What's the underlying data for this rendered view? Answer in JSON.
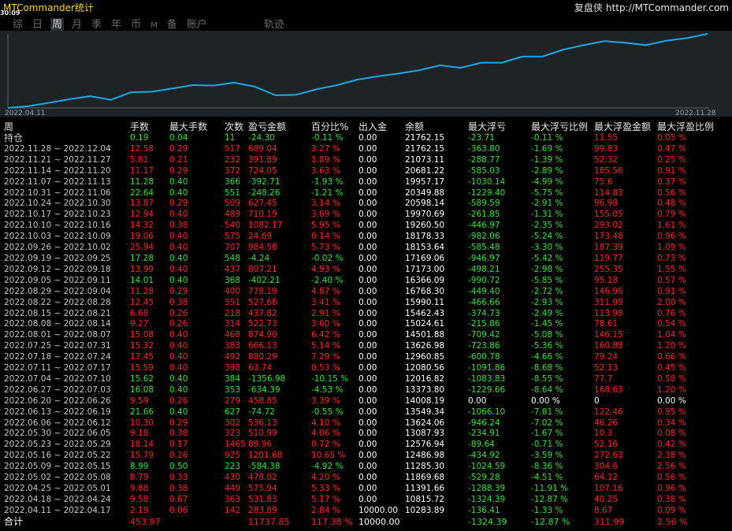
{
  "app": {
    "title": "MTCommander统计",
    "time": "30:09",
    "brand_cn": "复盘侠",
    "brand_url": "http://MTCommander.com"
  },
  "tabs": [
    {
      "label": "综",
      "active": false
    },
    {
      "label": "日",
      "active": false
    },
    {
      "label": "周",
      "active": true
    },
    {
      "label": "月",
      "active": false
    },
    {
      "label": "季",
      "active": false
    },
    {
      "label": "年",
      "active": false
    },
    {
      "label": "币",
      "active": false
    },
    {
      "label": "M",
      "active": false
    },
    {
      "label": "备",
      "active": false
    },
    {
      "label": "账户",
      "active": false
    },
    {
      "label": "轨迹",
      "active": false
    }
  ],
  "chart_data": {
    "type": "line",
    "x_start_label": "2022.04.11",
    "x_end_label": "2022.11.28",
    "line_color": "#1aa7e6",
    "series": [
      {
        "values": [
          10000,
          10283.89,
          10815.72,
          11391.66,
          11869.68,
          11285.3,
          12486.98,
          12576.64,
          13087.93,
          13624.06,
          13549.34,
          14008.19,
          13373.8,
          12016.82,
          12080.56,
          12960.85,
          13626.98,
          14501.88,
          15024.61,
          15462.43,
          15990.11,
          16768.3,
          16366.09,
          17173.0,
          17169.06,
          18153.64,
          18178.33,
          19260.5,
          19970.69,
          20598.14,
          20349.88,
          19957.17,
          20681.22,
          21073.11,
          21762.15
        ]
      }
    ]
  },
  "table": {
    "headers": [
      "周",
      "手数",
      "最大手数",
      "次数",
      "盈亏金额",
      "百分比%",
      "出入金",
      "余额",
      "最大浮亏",
      "最大浮亏比例",
      "最大浮盈金额",
      "最大浮盈比例"
    ],
    "holding": [
      "持仓",
      "0.19",
      "0.04",
      "11",
      "-24.30",
      "-0.11 %",
      "0.00",
      "21762.15",
      "-23.71",
      "-0.11 %",
      "11.55",
      "0.05 %"
    ],
    "rows": [
      [
        "2022.11.28 ~ 2022.12.04",
        "12.58",
        "0.29",
        "517",
        "689.04",
        "3.27 %",
        "0.00",
        "21762.15",
        "-363.80",
        "-1.69 %",
        "99.83",
        "0.47 %"
      ],
      [
        "2022.11.21 ~ 2022.11.27",
        "5.81",
        "0.21",
        "232",
        "391.89",
        "1.89 %",
        "0.00",
        "21073.11",
        "-288.77",
        "-1.39 %",
        "52.32",
        "0.25 %"
      ],
      [
        "2022.11.14 ~ 2022.11.20",
        "11.17",
        "0.29",
        "372",
        "724.05",
        "3.63 %",
        "0.00",
        "20681.22",
        "-585.03",
        "-2.89 %",
        "185.56",
        "0.91 %"
      ],
      [
        "2022.11.07 ~ 2022.11.13",
        "11.28",
        "0.40",
        "366",
        "-392.71",
        "-1.93 %",
        "0.00",
        "19957.17",
        "-1030.14",
        "-4.99 %",
        "75.6",
        "0.37 %"
      ],
      [
        "2022.10.31 ~ 2022.11.06",
        "22.64",
        "0.40",
        "551",
        "-248.26",
        "-1.21 %",
        "0.00",
        "20349.88",
        "-1229.40",
        "-5.75 %",
        "114.83",
        "0.56 %"
      ],
      [
        "2022.10.24 ~ 2022.10.30",
        "13.87",
        "0.29",
        "509",
        "627.45",
        "3.14 %",
        "0.00",
        "20598.14",
        "-589.59",
        "-2.91 %",
        "96.98",
        "0.48 %"
      ],
      [
        "2022.10.17 ~ 2022.10.23",
        "12.94",
        "0.40",
        "489",
        "710.19",
        "3.69 %",
        "0.00",
        "19970.69",
        "-261.85",
        "-1.31 %",
        "155.05",
        "0.79 %"
      ],
      [
        "2022.10.10 ~ 2022.10.16",
        "14.32",
        "0.38",
        "540",
        "1082.17",
        "5.95 %",
        "0.00",
        "19260.50",
        "-446.97",
        "-2.35 %",
        "293.02",
        "1.61 %"
      ],
      [
        "2022.10.03 ~ 2022.10.09",
        "19.06",
        "0.40",
        "575",
        "24.69",
        "0.14 %",
        "0.00",
        "18178.33",
        "-982.06",
        "-5.24 %",
        "173.48",
        "0.96 %"
      ],
      [
        "2022.09.26 ~ 2022.10.02",
        "25.94",
        "0.40",
        "707",
        "984.58",
        "5.73 %",
        "0.00",
        "18153.64",
        "-585.48",
        "-3.30 %",
        "187.39",
        "1.09 %"
      ],
      [
        "2022.09.19 ~ 2022.09.25",
        "17.28",
        "0.40",
        "548",
        "-4.24",
        "-0.02 %",
        "0.00",
        "17169.06",
        "-946.97",
        "-5.42 %",
        "119.77",
        "0.73 %"
      ],
      [
        "2022.09.12 ~ 2022.09.18",
        "13.99",
        "0.40",
        "437",
        "807.21",
        "4.93 %",
        "0.00",
        "17173.00",
        "-498.21",
        "-2.98 %",
        "255.35",
        "1.55 %"
      ],
      [
        "2022.09.05 ~ 2022.09.11",
        "14.01",
        "0.40",
        "368",
        "-402.21",
        "-2.40 %",
        "0.00",
        "16366.09",
        "-990.72",
        "-5.85 %",
        "95.18",
        "0.57 %"
      ],
      [
        "2022.08.29 ~ 2022.09.04",
        "11.28",
        "0.29",
        "400",
        "778.19",
        "4.87 %",
        "0.00",
        "16768.30",
        "-449.40",
        "-2.72 %",
        "146.96",
        "0.91 %"
      ],
      [
        "2022.08.22 ~ 2022.08.28",
        "12.45",
        "0.38",
        "351",
        "527.68",
        "3.41 %",
        "0.00",
        "15990.11",
        "-466.66",
        "-2.93 %",
        "311.99",
        "2.00 %"
      ],
      [
        "2022.08.15 ~ 2022.08.21",
        "6.68",
        "0.26",
        "218",
        "437.82",
        "2.91 %",
        "0.00",
        "15462.43",
        "-374.73",
        "-2.49 %",
        "113.98",
        "0.76 %"
      ],
      [
        "2022.08.08 ~ 2022.08.14",
        "9.27",
        "0.26",
        "314",
        "522.73",
        "3.60 %",
        "0.00",
        "15024.61",
        "-215.86",
        "-1.45 %",
        "78.61",
        "0.54 %"
      ],
      [
        "2022.08.01 ~ 2022.08.07",
        "15.08",
        "0.40",
        "468",
        "874.90",
        "6.42 %",
        "0.00",
        "14501.88",
        "-709.42",
        "-5.08 %",
        "146.15",
        "1.04 %"
      ],
      [
        "2022.07.25 ~ 2022.07.31",
        "15.32",
        "0.40",
        "383",
        "666.13",
        "5.14 %",
        "0.00",
        "13626.98",
        "-723.86",
        "-5.36 %",
        "160.88",
        "1.20 %"
      ],
      [
        "2022.07.18 ~ 2022.07.24",
        "17.45",
        "0.40",
        "492",
        "880.29",
        "7.29 %",
        "0.00",
        "12960.85",
        "-600.78",
        "-4.66 %",
        "79.24",
        "0.66 %"
      ],
      [
        "2022.07.11 ~ 2022.07.17",
        "15.59",
        "0.40",
        "398",
        "63.74",
        "0.53 %",
        "0.00",
        "12080.56",
        "-1091.86",
        "-8.68 %",
        "52.13",
        "0.45 %"
      ],
      [
        "2022.07.04 ~ 2022.07.10",
        "15.62",
        "0.40",
        "384",
        "-1356.98",
        "-10.15 %",
        "0.00",
        "12016.82",
        "-1083.83",
        "-8.55 %",
        "77.7",
        "0.58 %"
      ],
      [
        "2022.06.27 ~ 2022.07.03",
        "16.08",
        "0.40",
        "353",
        "-634.39",
        "-4.53 %",
        "0.00",
        "13373.80",
        "-1229.66",
        "-8.64 %",
        "168.63",
        "1.20 %"
      ],
      [
        "2022.06.20 ~ 2022.06.26",
        "9.59",
        "0.26",
        "279",
        "458.85",
        "3.39 %",
        "0.00",
        "14008.19",
        "0.00",
        "0.00 %",
        "0",
        "0.00 %"
      ],
      [
        "2022.06.13 ~ 2022.06.19",
        "21.66",
        "0.40",
        "627",
        "-74.72",
        "-0.55 %",
        "0.00",
        "13549.34",
        "-1066.10",
        "-7.81 %",
        "122.46",
        "0.95 %"
      ],
      [
        "2022.06.06 ~ 2022.06.12",
        "10.30",
        "0.29",
        "302",
        "536.13",
        "4.10 %",
        "0.00",
        "13624.06",
        "-946.24",
        "-7.02 %",
        "46.26",
        "0.34 %"
      ],
      [
        "2022.05.30 ~ 2022.06.05",
        "9.18",
        "0.38",
        "323",
        "510.99",
        "4.06 %",
        "0.00",
        "13087.93",
        "-234.91",
        "-1.67 %",
        "10.3",
        "0.08 %"
      ],
      [
        "2022.05.23 ~ 2022.05.29",
        "18.14",
        "0.17",
        "1465",
        "89.96",
        "0.72 %",
        "0.00",
        "12576.94",
        "-89.64",
        "-0.71 %",
        "52.16",
        "0.42 %"
      ],
      [
        "2022.05.16 ~ 2022.05.22",
        "15.79",
        "0.26",
        "925",
        "1201.68",
        "10.65 %",
        "0.00",
        "12486.98",
        "-434.92",
        "-3.59 %",
        "272.63",
        "2.38 %"
      ],
      [
        "2022.05.09 ~ 2022.05.15",
        "8.99",
        "0.50",
        "223",
        "-584.38",
        "-4.92 %",
        "0.00",
        "11285.30",
        "-1024.59",
        "-8.36 %",
        "304.6",
        "2.56 %"
      ],
      [
        "2022.05.02 ~ 2022.05.08",
        "8.79",
        "0.33",
        "430",
        "478.02",
        "4.20 %",
        "0.00",
        "11869.68",
        "-529.28",
        "-4.51 %",
        "64.12",
        "0.56 %"
      ],
      [
        "2022.04.25 ~ 2022.05.01",
        "9.88",
        "0.38",
        "449",
        "575.94",
        "5.33 %",
        "0.00",
        "11391.66",
        "-1288.39",
        "-11.91 %",
        "107.16",
        "0.96 %"
      ],
      [
        "2022.04.18 ~ 2022.04.24",
        "9.58",
        "0.67",
        "363",
        "531.83",
        "5.17 %",
        "0.00",
        "10815.72",
        "-1324.39",
        "-12.87 %",
        "40.25",
        "0.38 %"
      ],
      [
        "2022.04.11 ~ 2022.04.17",
        "2.19",
        "0.06",
        "142",
        "283.89",
        "2.84 %",
        "10000.00",
        "10283.89",
        "-136.41",
        "-1.33 %",
        "8.67",
        "0.09 %"
      ]
    ],
    "total": [
      "合计",
      "453.97",
      "",
      "",
      "11737.85",
      "117.38 %",
      "10000.00",
      "",
      "-1324.39",
      "-12.87 %",
      "311.99",
      "2.56 %"
    ]
  },
  "colors": {
    "positive": "#ff2424",
    "negative": "#2ee62e",
    "title": "#ffd800",
    "line": "#1aa7e6"
  }
}
